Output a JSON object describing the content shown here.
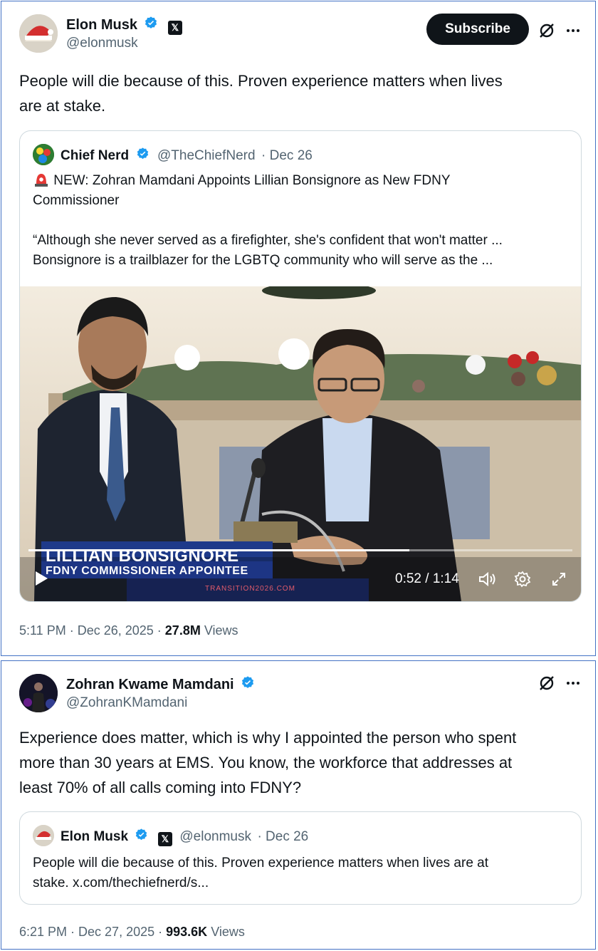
{
  "post1": {
    "author_name": "Elon Musk",
    "author_handle": "@elonmusk",
    "subscribe_label": "Subscribe",
    "text_line1": "People will die because of this. Proven experience matters when lives",
    "text_line2": "are at stake.",
    "quote": {
      "author_name": "Chief Nerd",
      "author_handle": "@TheChiefNerd",
      "date": "· Dec 26",
      "line1": "NEW: Zohran Mamdani Appoints Lillian Bonsignore as New FDNY",
      "line2": "Commissioner",
      "line3": "“Although she never served as a firefighter, she's confident that won't matter ...",
      "line4": "Bonsignore is a trailblazer for the LGBTQ community who will serve as the ...",
      "video": {
        "chyron_name": "LILLIAN BONSIGNORE",
        "chyron_title": "FDNY COMMISSIONER APPOINTEE",
        "chyron_source": "TRANSITION2026.COM",
        "time": "0:52 / 1:14",
        "progress": 0.7
      }
    },
    "time": "5:11 PM · Dec 26, 2025 ·",
    "views_count": "27.8M",
    "views_label": "Views"
  },
  "post2": {
    "author_name": "Zohran Kwame Mamdani",
    "author_handle": "@ZohranKMamdani",
    "text_line1": "Experience does matter, which is why I appointed the person who spent",
    "text_line2": "more than 30 years at EMS. You know, the workforce that addresses at",
    "text_line3": "least 70% of all calls coming into FDNY?",
    "quote": {
      "author_name": "Elon Musk",
      "author_handle": "@elonmusk",
      "date": "· Dec 26",
      "line1": "People will die because of this. Proven experience matters when lives are at",
      "line2": "stake. x.com/thechiefnerd/s..."
    },
    "time": "6:21 PM · Dec 27, 2025 ·",
    "views_count": "993.6K",
    "views_label": "Views"
  },
  "icons": [
    "verified-badge-icon",
    "x-badge-icon",
    "grok-icon",
    "more-icon",
    "siren-icon",
    "play-icon",
    "volume-icon",
    "settings-icon",
    "fullscreen-icon"
  ],
  "colors": {
    "verified": "#1d9bf0",
    "subscribe_bg": "#0f1419",
    "border": "#4472c4",
    "secondary_text": "#536471",
    "chyron": "#1e3a8a"
  }
}
